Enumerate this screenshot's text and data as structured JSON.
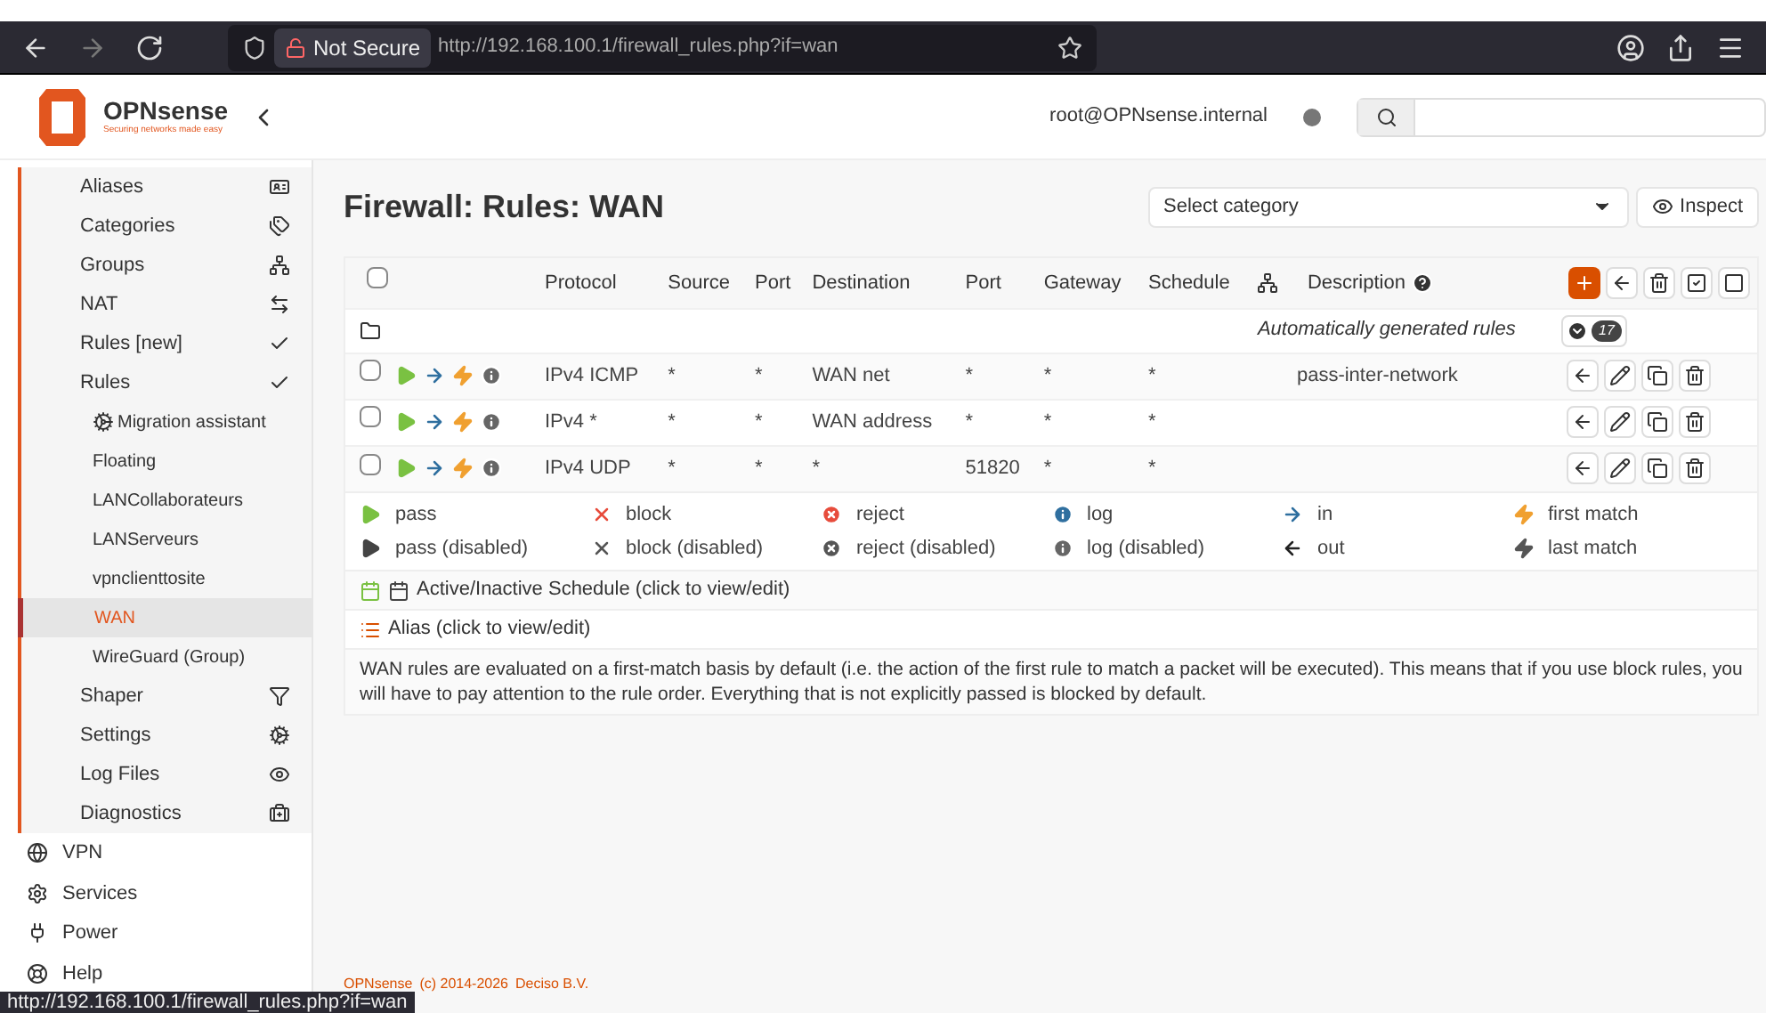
{
  "browser": {
    "url": "http://192.168.100.1/firewall_rules.php?if=wan",
    "security": "Not Secure"
  },
  "header": {
    "brand": "OPNsense",
    "tagline": "Securing networks made easy",
    "user": "root@OPNsense.internal"
  },
  "sidebar": {
    "items": [
      {
        "label": "Aliases"
      },
      {
        "label": "Categories"
      },
      {
        "label": "Groups"
      },
      {
        "label": "NAT"
      },
      {
        "label": "Rules [new]"
      },
      {
        "label": "Rules",
        "children": [
          {
            "label": "Migration assistant",
            "selected": false
          },
          {
            "label": "Floating",
            "selected": false
          },
          {
            "label": "LANCollaborateurs",
            "selected": false
          },
          {
            "label": "LANServeurs",
            "selected": false
          },
          {
            "label": "vpnclienttosite",
            "selected": false
          },
          {
            "label": "WAN",
            "selected": true
          },
          {
            "label": "WireGuard (Group)",
            "selected": false
          }
        ]
      },
      {
        "label": "Shaper"
      },
      {
        "label": "Settings"
      },
      {
        "label": "Log Files"
      },
      {
        "label": "Diagnostics"
      }
    ],
    "top_items": [
      {
        "label": "VPN"
      },
      {
        "label": "Services"
      },
      {
        "label": "Power"
      },
      {
        "label": "Help"
      }
    ]
  },
  "page": {
    "title": "Firewall: Rules: WAN",
    "category_select": {
      "placeholder": "Select category"
    },
    "inspect_button": "Inspect"
  },
  "table": {
    "all_checked": false,
    "columns": [
      "Protocol",
      "Source",
      "Port",
      "Destination",
      "Port",
      "Gateway",
      "Schedule",
      "Description"
    ],
    "rows": [
      {
        "kind": "group",
        "description": "Automatically generated rules",
        "count": "17"
      },
      {
        "kind": "rule",
        "checked": false,
        "protocol": "IPv4 ICMP",
        "source": "*",
        "source_port": "*",
        "destination": "WAN net",
        "destination_port": "*",
        "gateway": "*",
        "schedule": "*",
        "description": "pass-inter-network"
      },
      {
        "kind": "rule",
        "checked": false,
        "protocol": "IPv4 *",
        "source": "*",
        "source_port": "*",
        "destination": "WAN address",
        "destination_port": "*",
        "gateway": "*",
        "schedule": "*"
      },
      {
        "kind": "rule",
        "checked": false,
        "protocol": "IPv4 UDP",
        "source": "*",
        "source_port": "*",
        "destination": "*",
        "destination_port": "51820",
        "gateway": "*",
        "schedule": "*"
      }
    ]
  },
  "legend": [
    {
      "kind": "pass",
      "label": "pass"
    },
    {
      "kind": "block",
      "label": "block"
    },
    {
      "kind": "reject",
      "label": "reject"
    },
    {
      "kind": "log",
      "label": "log"
    },
    {
      "kind": "in",
      "label": "in"
    },
    {
      "kind": "first_match",
      "label": "first match"
    },
    {
      "kind": "pass_off",
      "label": "pass (disabled)"
    },
    {
      "kind": "block_off",
      "label": "block (disabled)"
    },
    {
      "kind": "reject_off",
      "label": "reject (disabled)"
    },
    {
      "kind": "log_off",
      "label": "log (disabled)"
    },
    {
      "kind": "out",
      "label": "out"
    },
    {
      "kind": "last_match",
      "label": "last match"
    }
  ],
  "schedule_note": "Active/Inactive Schedule (click to view/edit)",
  "alias_note": "Alias (click to view/edit)",
  "info_text": "WAN rules are evaluated on a first-match basis by default (i.e. the action of the first rule to match a packet will be executed). This means that if you use block rules, you will have to pay attention to the rule order. Everything that is not explicitly passed is blocked by default.",
  "footer": {
    "brand": "OPNsense",
    "copyright": "(c) 2014-2026",
    "company": "Deciso B.V."
  },
  "status_link": "http://192.168.100.1/firewall_rules.php?if=wan"
}
